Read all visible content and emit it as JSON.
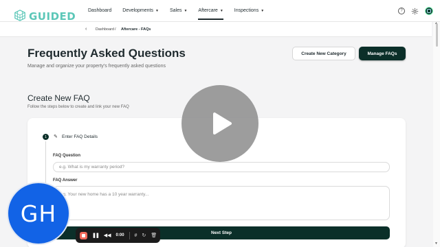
{
  "brand": {
    "name": "GUIDED",
    "accent": "#5cc7b8",
    "dark": "#0b2f29"
  },
  "nav": {
    "items": [
      {
        "label": "Dashboard",
        "caret": false,
        "active": false
      },
      {
        "label": "Developments",
        "caret": true,
        "active": false
      },
      {
        "label": "Sales",
        "caret": true,
        "active": false
      },
      {
        "label": "Aftercare",
        "caret": true,
        "active": true
      },
      {
        "label": "Inspections",
        "caret": true,
        "active": false
      }
    ],
    "icons": [
      "help-icon",
      "gear-icon",
      "avatar"
    ]
  },
  "breadcrumb": {
    "items": [
      "Dashboard",
      "Aftercare - FAQs"
    ],
    "separator": "/"
  },
  "header": {
    "title": "Frequently Asked Questions",
    "subtitle": "Manage and organize your property's frequently asked questions",
    "create_category_label": "Create New Category",
    "manage_faqs_label": "Manage FAQs"
  },
  "form": {
    "title": "Create New FAQ",
    "subtitle": "Follow the steps below to create and link your new FAQ",
    "step": {
      "number": "1",
      "title": "Enter FAQ Details"
    },
    "question_label": "FAQ Question",
    "question_placeholder": "e.g. What is my warranty period?",
    "answer_label": "FAQ Answer",
    "answer_placeholder": "e.g. Your new home has a 10 year warranty...",
    "next_label": "Next Step"
  },
  "recorder": {
    "time": "0:00",
    "avatar_initials": "GH"
  }
}
